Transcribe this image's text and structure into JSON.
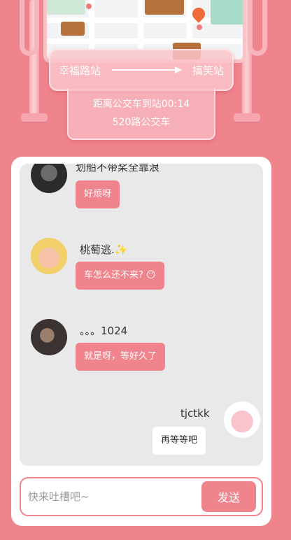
{
  "route": {
    "from_station": "幸福路站",
    "to_station": "搞笑站",
    "countdown_text": "距离公交车到站00:14",
    "bus_line": "520路公交车"
  },
  "messages": [
    {
      "sender": "划船不带桨全靠浪",
      "text": "好烦呀",
      "mine": false
    },
    {
      "sender": "桃萄逃.✨",
      "text": "车怎么还不来? 😶",
      "mine": false
    },
    {
      "sender": "。。。1024",
      "text": "就是呀，等好久了",
      "mine": false
    },
    {
      "sender": "tjctkk",
      "text": "再等等吧",
      "mine": true
    }
  ],
  "composer": {
    "placeholder": "快来吐槽吧~",
    "send_label": "发送"
  },
  "colors": {
    "primary": "#f0848d",
    "panel": "#ffffff",
    "list_bg": "#e9e9e9"
  }
}
